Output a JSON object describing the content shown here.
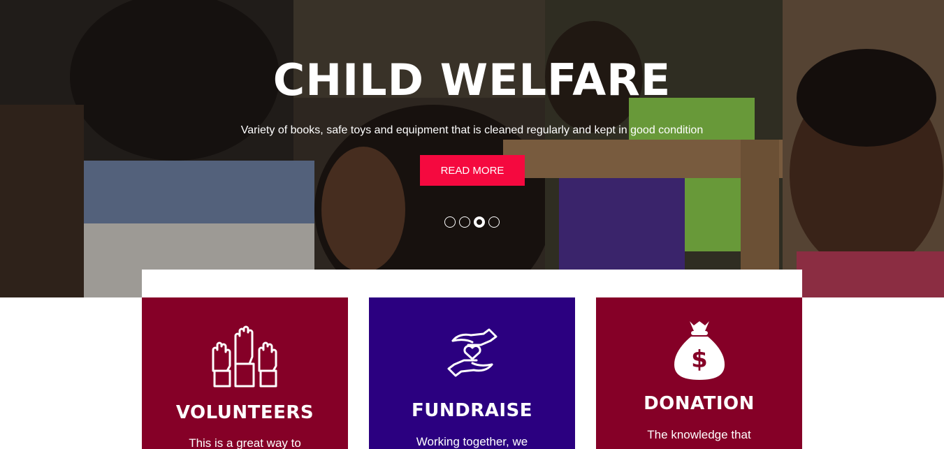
{
  "hero": {
    "title": "CHILD WELFARE",
    "subtitle": "Variety of books, safe toys and equipment that is cleaned regularly and kept in good condition",
    "button_label": "READ MORE",
    "slides_count": 4,
    "active_slide": 3
  },
  "cards": [
    {
      "title": "VOLUNTEERS",
      "text": "This is a great way to",
      "icon": "raised-hands-icon",
      "color": "#850027"
    },
    {
      "title": "FUNDRAISE",
      "text": "Working together, we",
      "icon": "hands-heart-icon",
      "color": "#2b0080"
    },
    {
      "title": "DONATION",
      "text": "The knowledge that",
      "icon": "money-bag-icon",
      "color": "#850027"
    }
  ],
  "colors": {
    "accent": "#f5093f",
    "card_red": "#850027",
    "card_purple": "#2b0080"
  }
}
